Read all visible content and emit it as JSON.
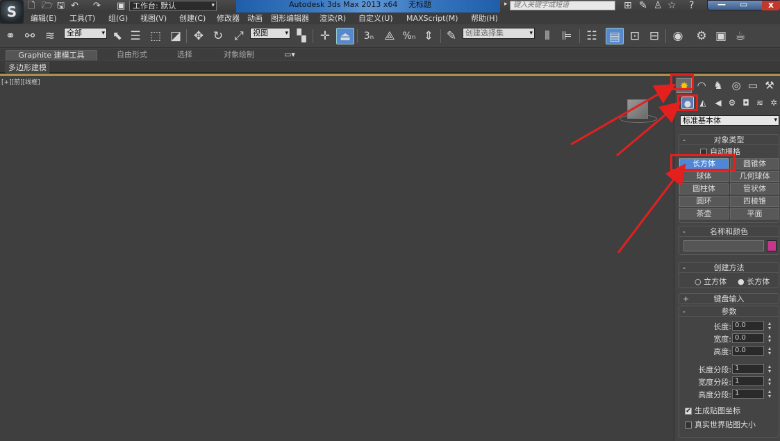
{
  "titlebar": {
    "app_logo": "S",
    "workspace": "工作台: 默认",
    "app_title": "Autodesk 3ds Max  2013 x64",
    "doc_title": "无标题",
    "search_placeholder": "键入关键字或短语",
    "icons": [
      "new-icon",
      "open-icon",
      "save-icon",
      "undo-icon",
      "redo-icon",
      "project-icon",
      "binoculars-icon",
      "tools-icon",
      "star-icon",
      "help-icon"
    ]
  },
  "menubar": {
    "items": [
      "编辑(E)",
      "工具(T)",
      "组(G)",
      "视图(V)",
      "创建(C)",
      "修改器",
      "动画",
      "图形编辑器",
      "渲染(R)",
      "自定义(U)",
      "MAXScript(M)",
      "帮助(H)"
    ]
  },
  "toolbar": {
    "selection_filter": "全部",
    "ref_coord": "视图",
    "named_selection": "创建选择集",
    "snap_labels": [
      "3",
      "%"
    ]
  },
  "ribbon": {
    "tabs": [
      "Graphite 建模工具",
      "自由形式",
      "选择",
      "对象绘制"
    ],
    "sub_label": "多边形建模"
  },
  "viewport": {
    "label": "[+][前][线框]"
  },
  "command_panel": {
    "category_dropdown": "标准基本体",
    "object_type": {
      "title": "对象类型",
      "autogrid": "自动栅格",
      "buttons": [
        "长方体",
        "圆锥体",
        "球体",
        "几何球体",
        "圆柱体",
        "管状体",
        "圆环",
        "四棱锥",
        "茶壶",
        "平面"
      ]
    },
    "name_color": {
      "title": "名称和颜色",
      "name_value": "",
      "swatch_color": "#c8358f"
    },
    "creation_method": {
      "title": "创建方法",
      "options": [
        "立方体",
        "长方体"
      ],
      "selected": "长方体"
    },
    "keyboard_entry": {
      "title": "键盘输入"
    },
    "parameters": {
      "title": "参数",
      "length_label": "长度:",
      "length": "0.0",
      "width_label": "宽度:",
      "width": "0.0",
      "height_label": "高度:",
      "height": "0.0",
      "length_segs_label": "长度分段:",
      "length_segs": "1",
      "width_segs_label": "宽度分段:",
      "width_segs": "1",
      "height_segs_label": "高度分段:",
      "height_segs": "1",
      "gen_map_coords": "生成贴图坐标",
      "real_world_map": "真实世界贴图大小"
    }
  },
  "colors": {
    "accent_active": "#4f86d6",
    "annotation": "#e4201f",
    "viewport_border": "#c9a64a"
  }
}
